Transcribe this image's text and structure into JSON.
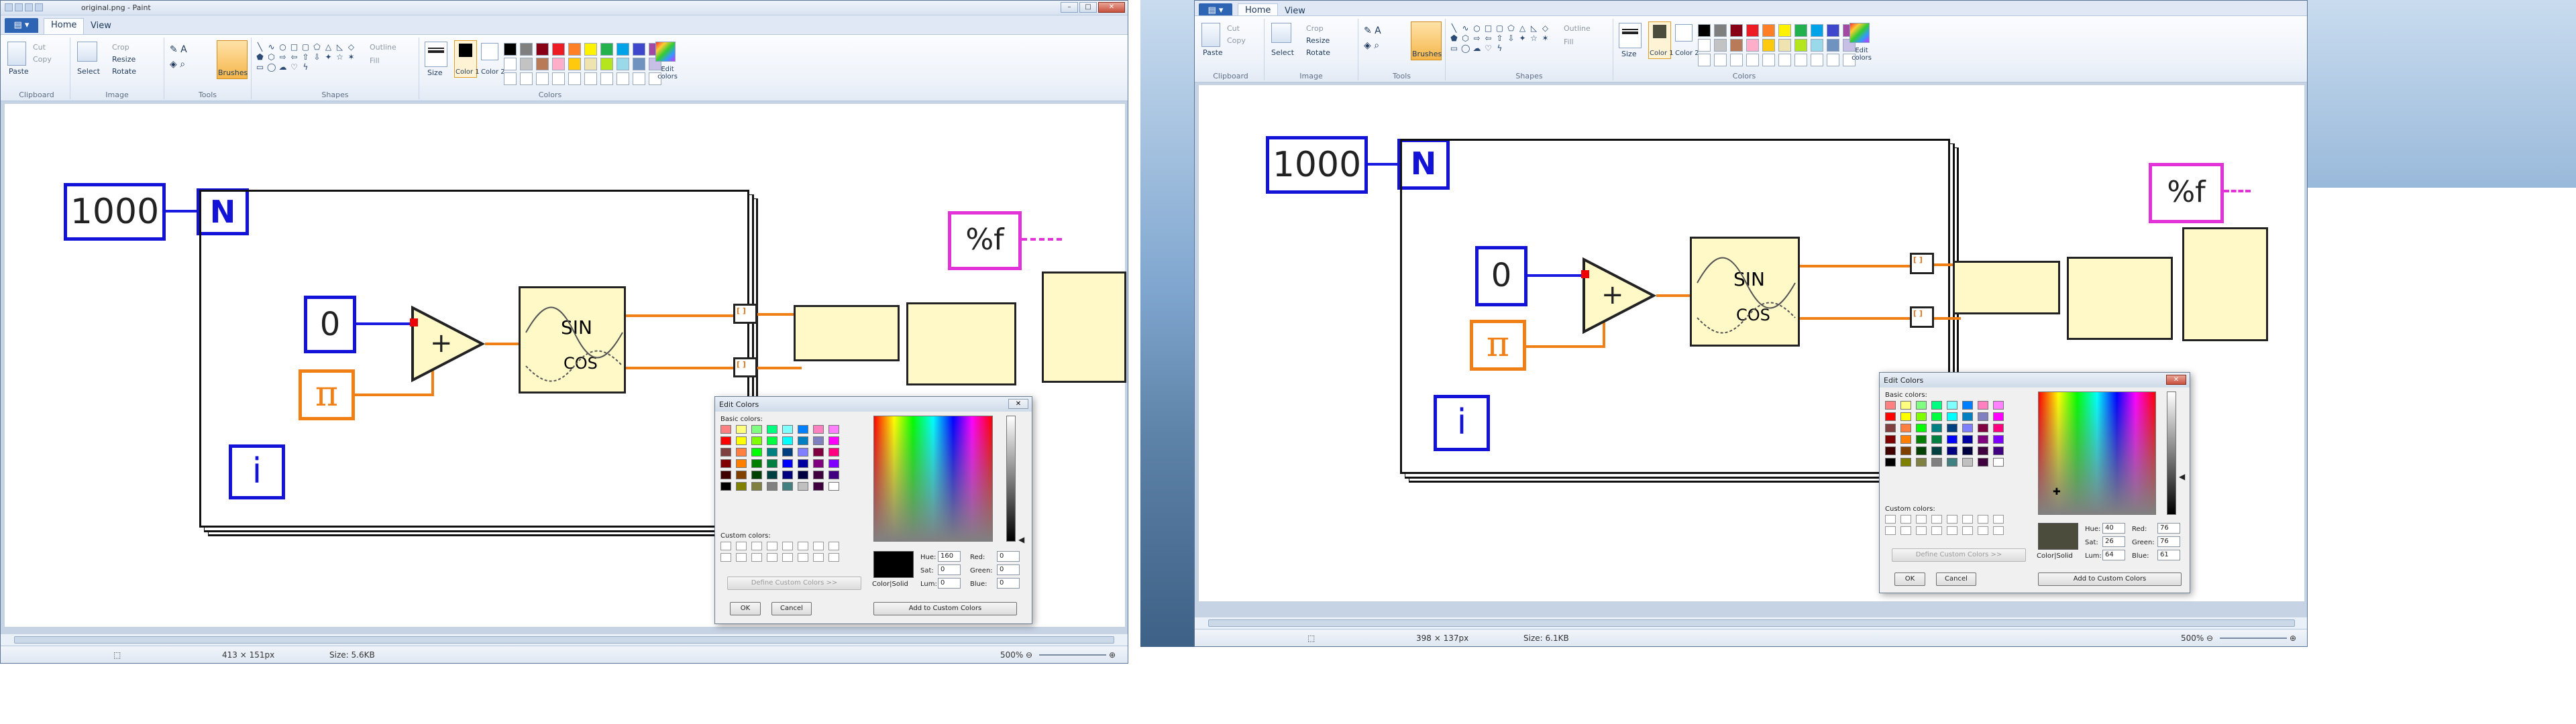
{
  "left_window": {
    "title": "original.png - Paint",
    "tabs": [
      "Home",
      "View"
    ],
    "groups": [
      "Clipboard",
      "Image",
      "Tools",
      "Shapes",
      "Colors"
    ],
    "clipboard": {
      "paste": "Paste",
      "cut": "Cut",
      "copy": "Copy"
    },
    "image": {
      "select": "Select",
      "crop": "Crop",
      "resize": "Resize",
      "rotate": "Rotate"
    },
    "tools": {
      "brushes": "Brushes"
    },
    "shapes": {
      "outline": "Outline",
      "fill": "Fill"
    },
    "size_label": "Size",
    "color1": "Color 1",
    "color2": "Color 2",
    "edit_colors": "Edit colors",
    "status": {
      "cursor": "413 × 151px",
      "size": "Size: 5.6KB",
      "zoom": "500%"
    },
    "diagram": {
      "iterations": "1000",
      "n": "N",
      "zero": "0",
      "pi": "π",
      "i": "i",
      "format": "%f",
      "sin": "SIN",
      "cos": "COS"
    },
    "dialog": {
      "title": "Edit Colors",
      "basic": "Basic colors:",
      "custom": "Custom colors:",
      "define": "Define Custom Colors >>",
      "colorsolid": "Color|Solid",
      "hue_label": "Hue:",
      "sat_label": "Sat:",
      "lum_label": "Lum:",
      "red_label": "Red:",
      "green_label": "Green:",
      "blue_label": "Blue:",
      "hue": "160",
      "sat": "0",
      "lum": "0",
      "red": "0",
      "green": "0",
      "blue": "0",
      "ok": "OK",
      "cancel": "Cancel",
      "add": "Add to Custom Colors"
    }
  },
  "right_window": {
    "tabs": [
      "Home",
      "View"
    ],
    "groups": [
      "Clipboard",
      "Image",
      "Tools",
      "Shapes",
      "Colors"
    ],
    "clipboard": {
      "paste": "Paste",
      "cut": "Cut",
      "copy": "Copy"
    },
    "image": {
      "select": "Select",
      "crop": "Crop",
      "resize": "Resize",
      "rotate": "Rotate"
    },
    "tools": {
      "brushes": "Brushes"
    },
    "shapes": {
      "outline": "Outline",
      "fill": "Fill"
    },
    "size_label": "Size",
    "color1": "Color 1",
    "color2": "Color 2",
    "edit_colors": "Edit colors",
    "status": {
      "cursor": "398 × 137px",
      "size": "Size: 6.1KB",
      "zoom": "500%"
    },
    "diagram": {
      "iterations": "1000",
      "n": "N",
      "zero": "0",
      "pi": "π",
      "i": "i",
      "format": "%f",
      "sin": "SIN",
      "cos": "COS"
    },
    "dialog": {
      "title": "Edit Colors",
      "basic": "Basic colors:",
      "custom": "Custom colors:",
      "define": "Define Custom Colors >>",
      "colorsolid": "Color|Solid",
      "hue_label": "Hue:",
      "sat_label": "Sat:",
      "lum_label": "Lum:",
      "red_label": "Red:",
      "green_label": "Green:",
      "blue_label": "Blue:",
      "hue": "40",
      "sat": "26",
      "lum": "64",
      "red": "76",
      "green": "76",
      "blue": "61",
      "ok": "OK",
      "cancel": "Cancel",
      "add": "Add to Custom Colors"
    }
  },
  "palette": [
    "#000000",
    "#7f7f7f",
    "#880015",
    "#ed1c24",
    "#ff7f27",
    "#fff200",
    "#22b14c",
    "#00a2e8",
    "#3f48cc",
    "#a349a4",
    "#ffffff",
    "#c3c3c3",
    "#b97a57",
    "#ffaec9",
    "#ffc90e",
    "#efe4b0",
    "#b5e61d",
    "#99d9ea",
    "#7092be",
    "#c8bfe7"
  ],
  "basic_colors": [
    "#ff8080",
    "#ffff80",
    "#80ff80",
    "#00ff80",
    "#80ffff",
    "#0080ff",
    "#ff80c0",
    "#ff80ff",
    "#ff0000",
    "#ffff00",
    "#80ff00",
    "#00ff40",
    "#00ffff",
    "#0080c0",
    "#8080c0",
    "#ff00ff",
    "#804040",
    "#ff8040",
    "#00ff00",
    "#008080",
    "#004080",
    "#8080ff",
    "#800040",
    "#ff0080",
    "#800000",
    "#ff8000",
    "#008000",
    "#008040",
    "#0000ff",
    "#0000a0",
    "#800080",
    "#8000ff",
    "#400000",
    "#804000",
    "#004000",
    "#004040",
    "#000080",
    "#000040",
    "#400040",
    "#400080",
    "#000000",
    "#808000",
    "#808040",
    "#808080",
    "#408080",
    "#c0c0c0",
    "#400040",
    "#ffffff"
  ],
  "colors": {
    "selected_left": "#000000",
    "selected_right": "#4c4c3d",
    "accent": "#f0a030"
  }
}
